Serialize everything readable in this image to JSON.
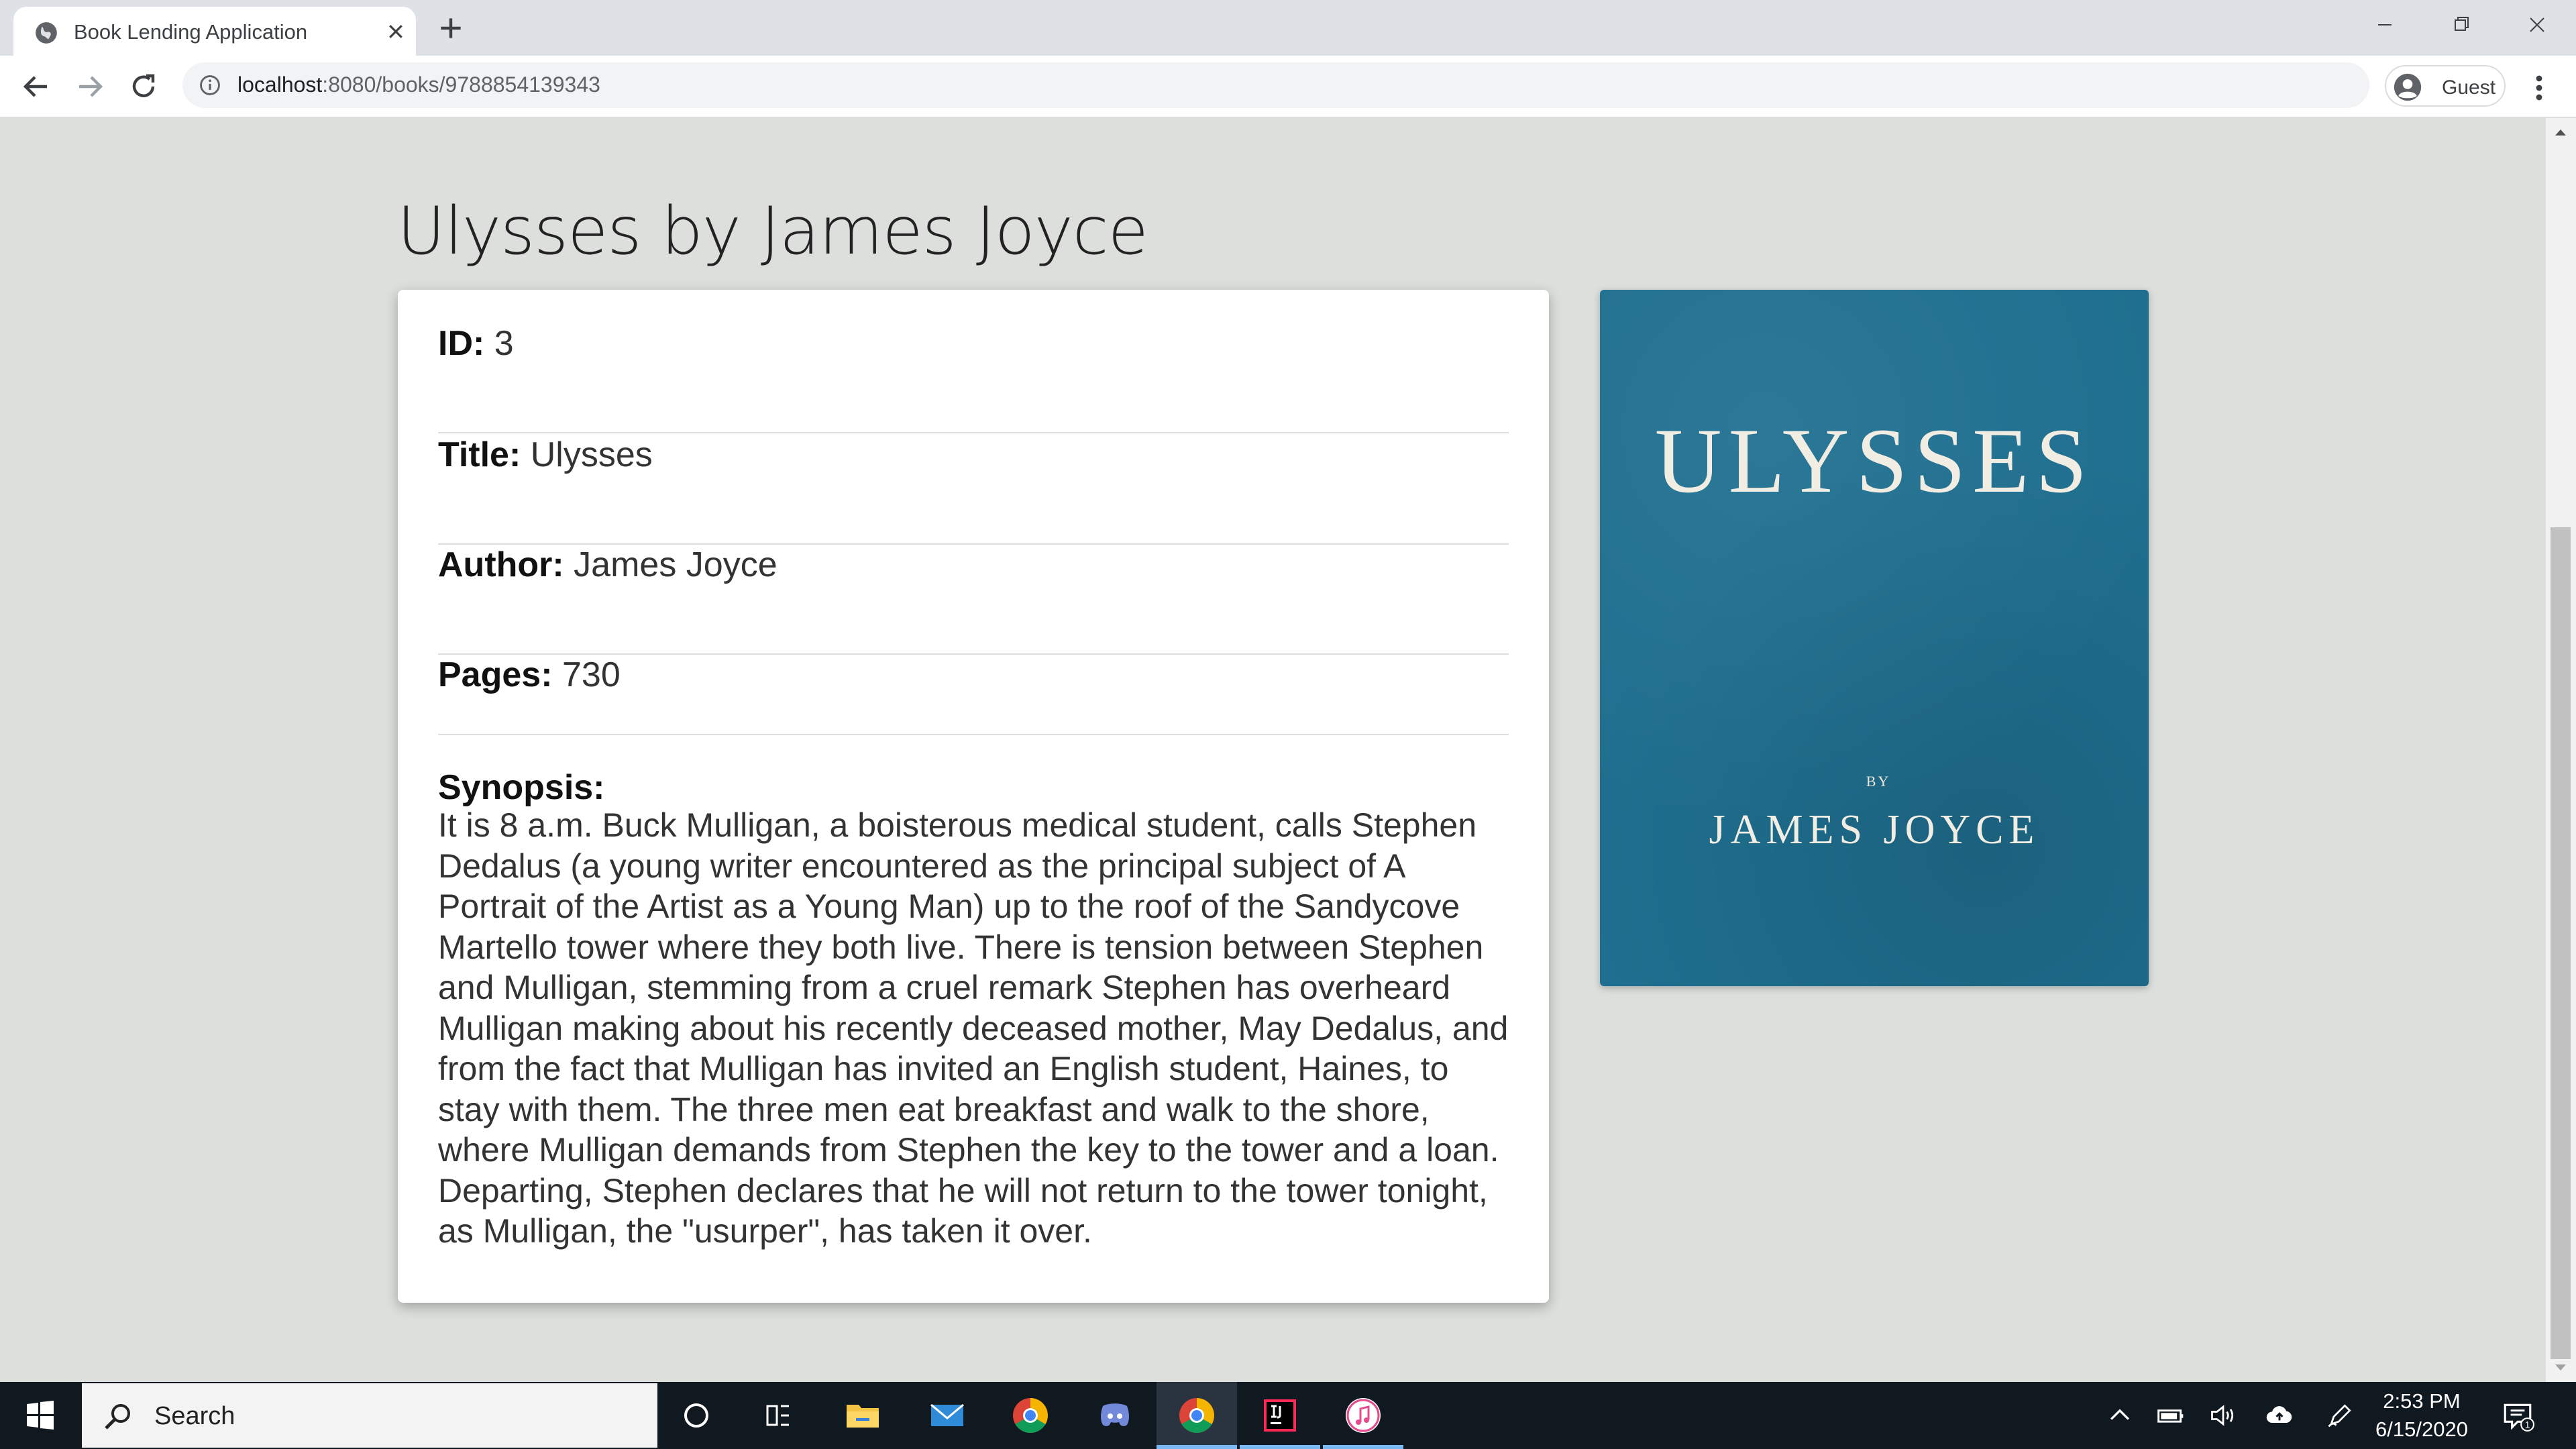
{
  "browser": {
    "tab_title": "Book Lending Application",
    "url_host": "localhost",
    "url_path": ":8080/books/9788854139343",
    "profile_name": "Guest"
  },
  "page": {
    "title": "Ulysses by James Joyce",
    "fields": {
      "id_label": "ID:",
      "id_value": "3",
      "title_label": "Title:",
      "title_value": "Ulysses",
      "author_label": "Author:",
      "author_value": "James Joyce",
      "pages_label": "Pages:",
      "pages_value": "730",
      "synopsis_label": "Synopsis:",
      "synopsis_text": "It is 8 a.m. Buck Mulligan, a boisterous medical student, calls Stephen Dedalus (a young writer encountered as the principal subject of A Portrait of the Artist as a Young Man) up to the roof of the Sandycove Martello tower where they both live. There is tension between Stephen and Mulligan, stemming from a cruel remark Stephen has overheard Mulligan making about his recently deceased mother, May Dedalus, and from the fact that Mulligan has invited an English student, Haines, to stay with them. The three men eat breakfast and walk to the shore, where Mulligan demands from Stephen the key to the tower and a loan. Departing, Stephen declares that he will not return to the tower tonight, as Mulligan, the \"usurper\", has taken it over."
    },
    "cover": {
      "title": "ULYSSES",
      "by": "BY",
      "author": "JAMES JOYCE",
      "color": "#1f6f90"
    }
  },
  "taskbar": {
    "search_placeholder": "Search",
    "time": "2:53 PM",
    "date": "6/15/2020",
    "notification_count": "1",
    "apps": [
      "cortana-icon",
      "task-view-icon",
      "file-explorer-icon",
      "mail-icon",
      "chrome-icon",
      "discord-icon",
      "chrome-icon",
      "intellij-icon",
      "itunes-icon"
    ]
  }
}
